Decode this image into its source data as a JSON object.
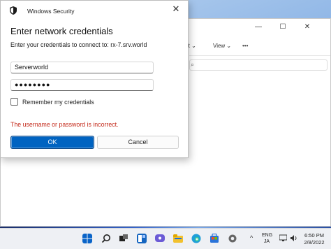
{
  "dialog": {
    "app_name": "Windows Security",
    "close_label": "✕",
    "title": "Enter network credentials",
    "subtitle": "Enter your credentials to connect to: rx-7.srv.world",
    "username_value": "Serverworld",
    "password_value": "●●●●●●●●",
    "remember_label": "Remember my credentials",
    "error_text": "The username or password is incorrect.",
    "ok_label": "OK",
    "cancel_label": "Cancel"
  },
  "explorer": {
    "minimize": "—",
    "maximize": "☐",
    "close": "✕",
    "toolbar_sort": "rt ⌄",
    "toolbar_view": "View ⌄",
    "toolbar_more": "•••"
  },
  "taskbar": {
    "lang_top": "ENG",
    "lang_bottom": "JA",
    "time": "6:50 PM",
    "date": "2/8/2022",
    "tray_arrow": "^"
  },
  "colors": {
    "accent": "#0063c1",
    "error": "#c42b1c"
  }
}
